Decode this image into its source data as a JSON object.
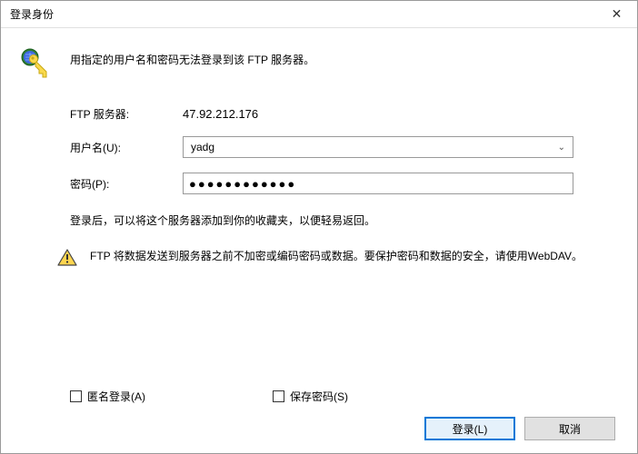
{
  "title": "登录身份",
  "hero_text": "用指定的用户名和密码无法登录到该 FTP 服务器。",
  "labels": {
    "server": "FTP 服务器:",
    "user": "用户名(U):",
    "password": "密码(P):"
  },
  "server_value": "47.92.212.176",
  "username": "yadg",
  "password_mask": "●●●●●●●●●●●●",
  "after_login": "登录后，可以将这个服务器添加到你的收藏夹，以便轻易返回。",
  "warning": "FTP 将数据发送到服务器之前不加密或编码密码或数据。要保护密码和数据的安全，请使用WebDAV。",
  "checkboxes": {
    "anonymous": "匿名登录(A)",
    "save_pw": "保存密码(S)"
  },
  "buttons": {
    "login": "登录(L)",
    "cancel": "取消"
  }
}
